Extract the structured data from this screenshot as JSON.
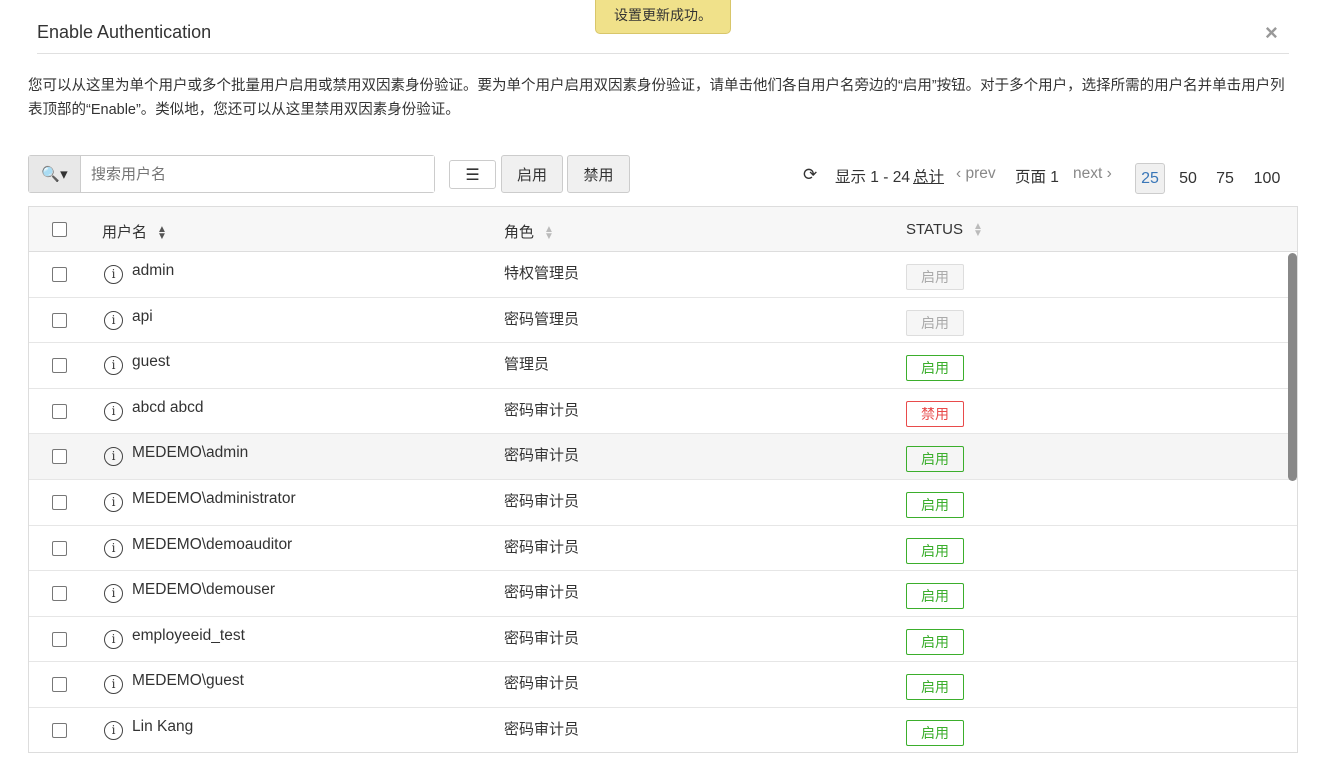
{
  "dialog": {
    "title": "Enable Authentication",
    "close": "×"
  },
  "toast": "设置更新成功。",
  "description": "您可以从这里为单个用户或多个批量用户启用或禁用双因素身份验证。要为单个用户启用双因素身份验证，请单击他们各自用户名旁边的“启用”按钮。对于多个用户，选择所需的用户名并单击用户列表顶部的“Enable”。类似地，您还可以从这里禁用双因素身份验证。",
  "toolbar": {
    "search_placeholder": "搜索用户名",
    "enable": "启用",
    "disable": "禁用"
  },
  "pager": {
    "showing": "显示 1 - 24",
    "total": "总计",
    "prev": "prev",
    "page": "页面 1",
    "next": "next",
    "sizes": [
      "25",
      "50",
      "75",
      "100"
    ],
    "selected_size": "25"
  },
  "table": {
    "headers": [
      "用户名",
      "角色",
      "STATUS"
    ],
    "rows": [
      {
        "user": "admin",
        "role": "特权管理员",
        "status": "启用",
        "state": "dis"
      },
      {
        "user": "api",
        "role": "密码管理员",
        "status": "启用",
        "state": "dis"
      },
      {
        "user": "guest",
        "role": "管理员",
        "status": "启用",
        "state": "en"
      },
      {
        "user": "abcd abcd",
        "role": "密码审计员",
        "status": "禁用",
        "state": "off"
      },
      {
        "user": "MEDEMO\\admin",
        "role": "密码审计员",
        "status": "启用",
        "state": "en"
      },
      {
        "user": "MEDEMO\\administrator",
        "role": "密码审计员",
        "status": "启用",
        "state": "en"
      },
      {
        "user": "MEDEMO\\demoauditor",
        "role": "密码审计员",
        "status": "启用",
        "state": "en"
      },
      {
        "user": "MEDEMO\\demouser",
        "role": "密码审计员",
        "status": "启用",
        "state": "en"
      },
      {
        "user": "employeeid_test",
        "role": "密码审计员",
        "status": "启用",
        "state": "en"
      },
      {
        "user": "MEDEMO\\guest",
        "role": "密码审计员",
        "status": "启用",
        "state": "en"
      },
      {
        "user": "Lin Kang",
        "role": "密码审计员",
        "status": "启用",
        "state": "en"
      }
    ]
  },
  "colors": {
    "enabled": "#3bae2c",
    "disabled": "#e84b4b",
    "toast": "#f0e18a"
  }
}
